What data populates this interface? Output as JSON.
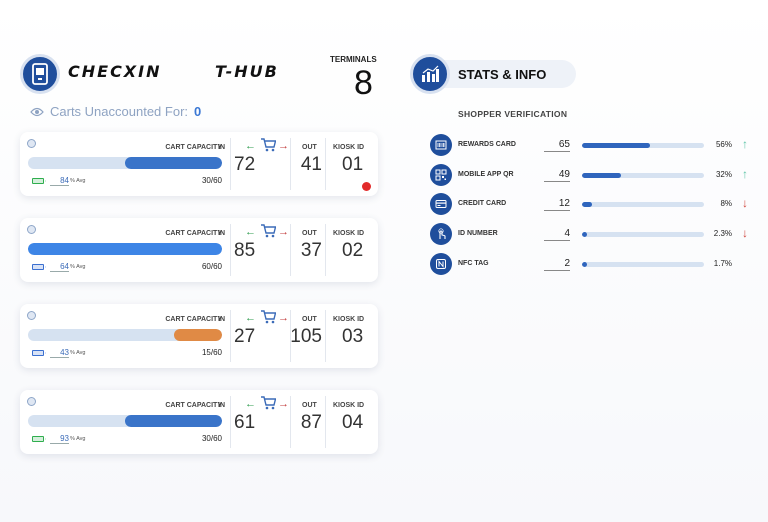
{
  "header": {
    "brand_name": "CHECXIN",
    "brand_product": "T-HUB",
    "terminals_label": "TERMINALS",
    "terminals_value": "8",
    "carts_label": "Carts Unaccounted For:",
    "carts_value": "0"
  },
  "labels": {
    "cart_capacity": "CART CAPACITY",
    "in": "IN",
    "out": "OUT",
    "kiosk_id": "KIOSK ID",
    "avg": "% Avg"
  },
  "kiosks": [
    {
      "capacity_fraction": 0.5,
      "capacity_text": "30/60",
      "avg": "84",
      "in": "72",
      "out": "41",
      "kiosk_id": "01",
      "bar_color": "#3a74c9",
      "battery_color": "#2fae4e",
      "alert": true
    },
    {
      "capacity_fraction": 1.0,
      "capacity_text": "60/60",
      "avg": "64",
      "in": "85",
      "out": "37",
      "kiosk_id": "02",
      "bar_color": "#3d85e6",
      "battery_color": "#3a6fd0",
      "alert": false
    },
    {
      "capacity_fraction": 0.25,
      "capacity_text": "15/60",
      "avg": "43",
      "in": "27",
      "out": "105",
      "kiosk_id": "03",
      "bar_color": "#e08a45",
      "battery_color": "#3a6fd0",
      "alert": false
    },
    {
      "capacity_fraction": 0.5,
      "capacity_text": "30/60",
      "avg": "93",
      "in": "61",
      "out": "87",
      "kiosk_id": "04",
      "bar_color": "#3a74c9",
      "battery_color": "#2fae4e",
      "alert": false
    }
  ],
  "stats": {
    "title": "STATS & INFO",
    "section_title": "SHOPPER VERIFICATION",
    "rows": [
      {
        "label": "REWARDS CARD",
        "count": "65",
        "pct": "56%",
        "fraction": 0.56,
        "trend": "up",
        "icon": "barcode-card-icon"
      },
      {
        "label": "MOBILE APP QR",
        "count": "49",
        "pct": "32%",
        "fraction": 0.32,
        "trend": "up",
        "icon": "qr-code-icon"
      },
      {
        "label": "CREDIT CARD",
        "count": "12",
        "pct": "8%",
        "fraction": 0.08,
        "trend": "down",
        "icon": "credit-card-icon"
      },
      {
        "label": "ID NUMBER",
        "count": "4",
        "pct": "2.3%",
        "fraction": 0.023,
        "trend": "down",
        "icon": "finger-tap-icon"
      },
      {
        "label": "NFC TAG",
        "count": "2",
        "pct": "1.7%",
        "fraction": 0.017,
        "trend": "none",
        "icon": "nfc-icon"
      }
    ]
  },
  "colors": {
    "brand_blue": "#1f4e9c",
    "trend_up": "#5fc4a8",
    "trend_down": "#d0463d"
  }
}
